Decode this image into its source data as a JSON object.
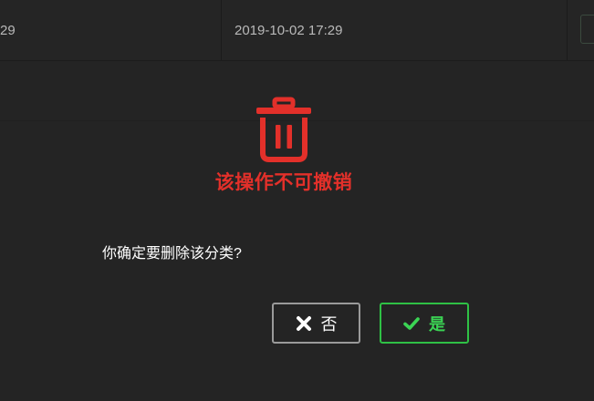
{
  "table": {
    "row": {
      "cell_a": "29",
      "cell_b": "2019-10-02 17:29"
    }
  },
  "dialog": {
    "icon": "trash-icon",
    "warning": "该操作不可撤销",
    "question": "你确定要删除该分类?",
    "buttons": {
      "no": {
        "label": "否",
        "icon": "close-icon"
      },
      "yes": {
        "label": "是",
        "icon": "check-icon"
      }
    }
  },
  "colors": {
    "background": "#242424",
    "danger": "#e3302a",
    "confirm": "#2fc145",
    "neutral_border": "#9a9a9a"
  }
}
